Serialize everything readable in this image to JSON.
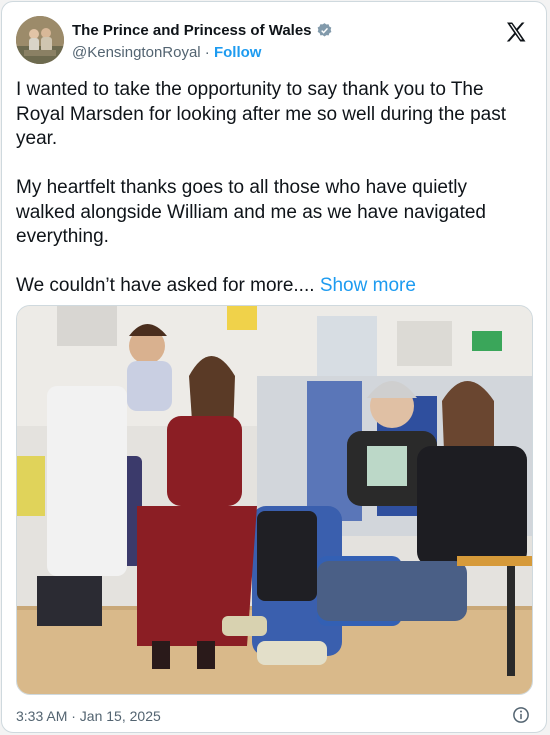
{
  "author": {
    "display_name": "The Prince and Princess of Wales",
    "handle": "@KensingtonRoyal",
    "separator": " · ",
    "follow_label": "Follow",
    "verified_color": "#829aab"
  },
  "post": {
    "paragraphs": [
      "I wanted to take the opportunity to say thank you to The Royal Marsden for looking after me so well during the past year.",
      "My heartfelt thanks goes to all those who have quietly walked alongside William and me as we have navigated everything."
    ],
    "last_line": "We couldn’t have asked for more....",
    "show_more_label": "Show more",
    "timestamp": "3:33 AM · Jan 15, 2025"
  },
  "icons": {
    "platform": "x-logo-icon",
    "verified": "verified-badge-icon",
    "info": "info-icon"
  },
  "colors": {
    "link": "#1d9bf0",
    "text": "#0f1419",
    "secondary": "#536471"
  }
}
